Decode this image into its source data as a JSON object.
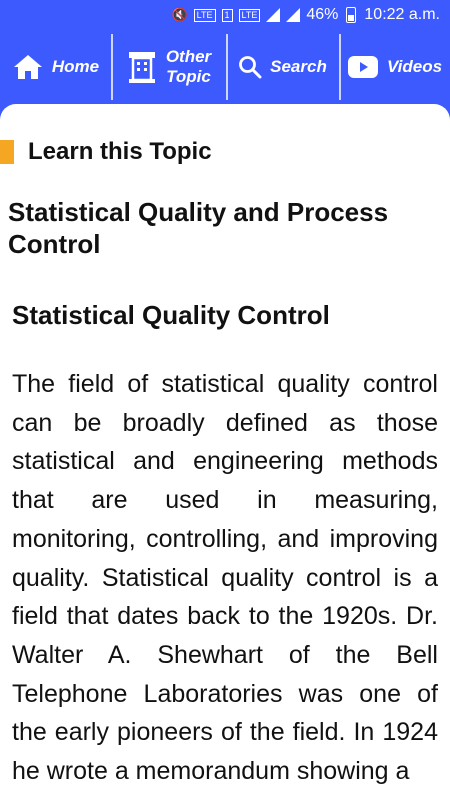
{
  "status": {
    "battery": "46%",
    "time": "10:22 a.m.",
    "lte1": "LTE",
    "lte2": "LTE",
    "sim": "1"
  },
  "nav": {
    "home": "Home",
    "other_line1": "Other",
    "other_line2": "Topic",
    "search": "Search",
    "videos": "Videos"
  },
  "content": {
    "learn_label": "Learn this Topic",
    "page_title": "Statistical Quality and Process Control",
    "section_title": "Statistical Quality Control",
    "paragraph": "The field of statistical quality control can be broadly defined as those statistical and engineering methods that are used in measuring, monitoring, controlling, and improving quality. Statistical quality control is a field that dates back to the 1920s. Dr. Walter A. Shewhart of the Bell Telephone Laboratories was one of the early pioneers of the field. In 1924 he wrote a memorandum showing a"
  },
  "colors": {
    "primary": "#3d5afe",
    "accent": "#f5a623"
  }
}
